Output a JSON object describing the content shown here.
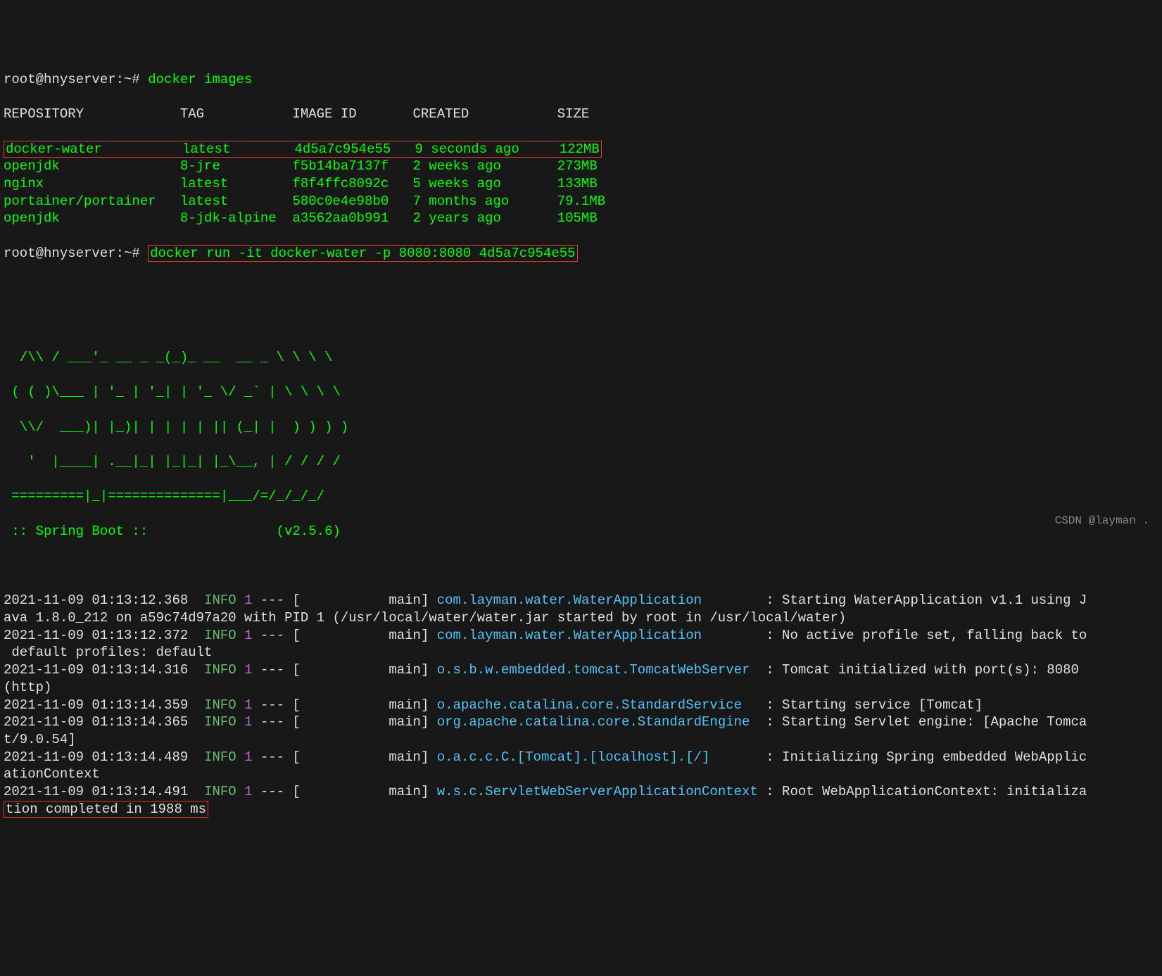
{
  "prompt": "root@hnyserver:~#",
  "cmd1": "docker images",
  "table": {
    "headers": {
      "repo": "REPOSITORY",
      "tag": "TAG",
      "id": "IMAGE ID",
      "created": "CREATED",
      "size": "SIZE"
    },
    "rows": [
      {
        "repo": "docker-water",
        "tag": "latest",
        "id": "4d5a7c954e55",
        "created": "9 seconds ago",
        "size": "122MB",
        "hl": true
      },
      {
        "repo": "openjdk",
        "tag": "8-jre",
        "id": "f5b14ba7137f",
        "created": "2 weeks ago",
        "size": "273MB"
      },
      {
        "repo": "nginx",
        "tag": "latest",
        "id": "f8f4ffc8092c",
        "created": "5 weeks ago",
        "size": "133MB"
      },
      {
        "repo": "portainer/portainer",
        "tag": "latest",
        "id": "580c0e4e98b0",
        "created": "7 months ago",
        "size": "79.1MB"
      },
      {
        "repo": "openjdk",
        "tag": "8-jdk-alpine",
        "id": "a3562aa0b991",
        "created": "2 years ago",
        "size": "105MB"
      }
    ]
  },
  "cmd2": "docker run -it docker-water -p 8080:8080 4d5a7c954e55",
  "banner": {
    "l1": "  /\\\\ / ___'_ __ _ _(_)_ __  __ _ \\ \\ \\ \\",
    "l2": " ( ( )\\___ | '_ | '_| | '_ \\/ _` | \\ \\ \\ \\",
    "l3": "  \\\\/  ___)| |_)| | | | | || (_| |  ) ) ) )",
    "l4": "   '  |____| .__|_| |_|_| |_\\__, | / / / /",
    "l5": " =========|_|==============|___/=/_/_/_/",
    "boot": " :: Spring Boot ::                (v2.5.6)"
  },
  "logs": [
    {
      "ts": "2021-11-09 01:13:12.368",
      "lvl": "INFO",
      "pid": "1",
      "thr": "main",
      "cls": "com.layman.water.WaterApplication",
      "msg": "Starting WaterApplication v1.1 using Java 1.8.0_212 on a59c74d97a20 with PID 1 (/usr/local/water/water.jar started by root in /usr/local/water)",
      "wrap": "J",
      "rest": "ava 1.8.0_212 on a59c74d97a20 with PID 1 (/usr/local/water/water.jar started by root in /usr/local/water)"
    },
    {
      "ts": "2021-11-09 01:13:12.372",
      "lvl": "INFO",
      "pid": "1",
      "thr": "main",
      "cls": "com.layman.water.WaterApplication",
      "msg": "No active profile set, falling back to default profiles: default",
      "wrap2": " default profiles: default"
    },
    {
      "ts": "2021-11-09 01:13:14.316",
      "lvl": "INFO",
      "pid": "1",
      "thr": "main",
      "cls": "o.s.b.w.embedded.tomcat.TomcatWebServer",
      "msg": "Tomcat initialized with port(s): 8080 (http)",
      "wrap2": "(http)"
    },
    {
      "ts": "2021-11-09 01:13:14.359",
      "lvl": "INFO",
      "pid": "1",
      "thr": "main",
      "cls": "o.apache.catalina.core.StandardService",
      "msg": "Starting service [Tomcat]"
    },
    {
      "ts": "2021-11-09 01:13:14.365",
      "lvl": "INFO",
      "pid": "1",
      "thr": "main",
      "cls": "org.apache.catalina.core.StandardEngine",
      "msg": "Starting Servlet engine: [Apache Tomcat/9.0.54]",
      "wrap2": "t/9.0.54]"
    },
    {
      "ts": "2021-11-09 01:13:14.489",
      "lvl": "INFO",
      "pid": "1",
      "thr": "main",
      "cls": "o.a.c.c.C.[Tomcat].[localhost].[/]",
      "msg": "Initializing Spring embedded WebApplicationContext",
      "wrap2": "ationContext"
    },
    {
      "ts": "2021-11-09 01:13:14.491",
      "lvl": "INFO",
      "pid": "1",
      "thr": "main",
      "cls": "w.s.c.ServletWebServerApplicationContext",
      "msg": "Root WebApplicationContext: initialization completed in 1988 ms",
      "wrap2": "tion completed in 1988 ms",
      "hl": true
    }
  ],
  "watermark": "CSDN @layman ."
}
